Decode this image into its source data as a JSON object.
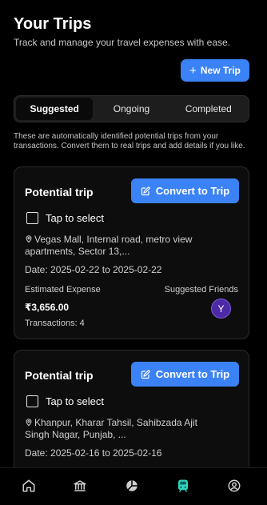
{
  "header": {
    "title": "Your Trips",
    "subtitle": "Track and manage your travel expenses with ease."
  },
  "new_trip_button": {
    "icon": "plus-icon",
    "label": "New Trip"
  },
  "tabs": [
    {
      "label": "Suggested",
      "active": true
    },
    {
      "label": "Ongoing",
      "active": false
    },
    {
      "label": "Completed",
      "active": false
    }
  ],
  "info_text": "These are automatically identified potential trips from your transactions. Convert them to real trips and add details if you like.",
  "trips": [
    {
      "title": "Potential trip",
      "convert_label": "Convert to Trip",
      "select_label": "Tap to select",
      "location": "Vegas Mall, Internal road, metro view apartments, Sector 13,...",
      "date": "Date: 2025-02-22 to 2025-02-22",
      "estimated_label": "Estimated Expense",
      "amount": "₹3,656.00",
      "transactions": "Transactions: 4",
      "friends_label": "Suggested Friends",
      "friend_initial": "Y"
    },
    {
      "title": "Potential trip",
      "convert_label": "Convert to Trip",
      "select_label": "Tap to select",
      "location": "Khanpur, Kharar Tahsil, Sahibzada Ajit Singh Nagar, Punjab, ...",
      "date": "Date: 2025-02-16 to 2025-02-16"
    }
  ],
  "bottom_nav": [
    {
      "icon": "home-icon",
      "active": false
    },
    {
      "icon": "bank-icon",
      "active": false
    },
    {
      "icon": "pie-chart-icon",
      "active": false
    },
    {
      "icon": "train-icon",
      "active": true
    },
    {
      "icon": "profile-icon",
      "active": false
    }
  ],
  "colors": {
    "accent": "#3b82f6",
    "active_nav": "#2dd4bf",
    "avatar": "#4c2aa6",
    "background": "#000000"
  }
}
